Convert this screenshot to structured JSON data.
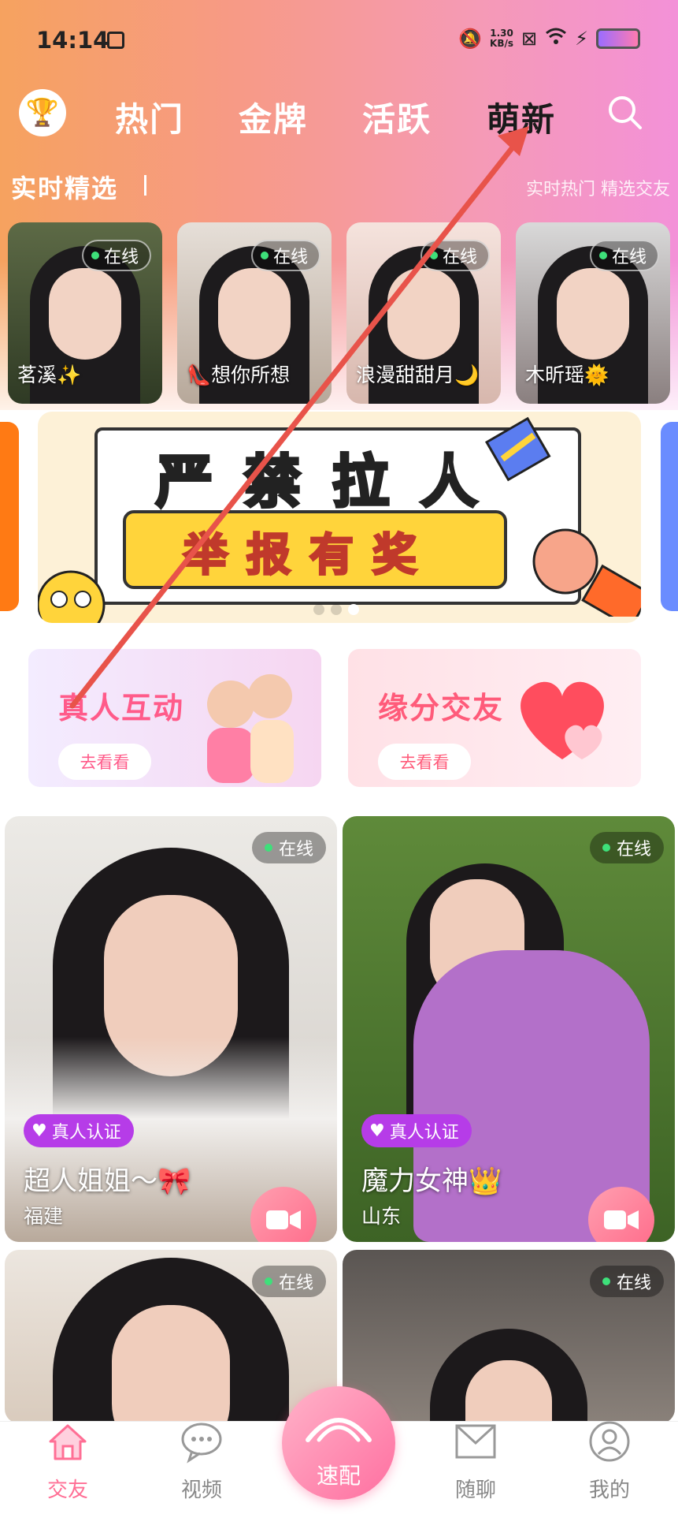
{
  "status": {
    "time": "14:14",
    "net_speed_value": "1.30",
    "net_speed_unit": "KB/s"
  },
  "nav": {
    "tabs": [
      "热门",
      "金牌",
      "活跃",
      "萌新"
    ],
    "active_tab": "萌新"
  },
  "section": {
    "title": "实时精选",
    "right_links": "实时热门  精选交友"
  },
  "live_cards": [
    {
      "badge": "在线",
      "name": "茗溪✨"
    },
    {
      "badge": "在线",
      "name": "👠想你所想"
    },
    {
      "badge": "在线",
      "name": "浪漫甜甜月🌙"
    },
    {
      "badge": "在线",
      "name": "木昕瑶🌞"
    }
  ],
  "banner": {
    "headline": "严禁拉人",
    "subline": "举报有奖"
  },
  "features": [
    {
      "title": "真人互动",
      "button": "去看看"
    },
    {
      "title": "缘分交友",
      "button": "去看看"
    }
  ],
  "profiles": [
    {
      "online": "在线",
      "verify": "真人认证",
      "nickname": "超人姐姐～🎀",
      "location": "福建"
    },
    {
      "online": "在线",
      "verify": "真人认证",
      "nickname": "魔力女神👑",
      "location": "山东"
    },
    {
      "online": "在线"
    },
    {
      "online": "在线"
    }
  ],
  "bottom_nav": {
    "items": [
      "交友",
      "视频",
      "速配",
      "随聊",
      "我的"
    ],
    "active": "交友"
  },
  "colors": {
    "accent_pink": "#ff6f95",
    "online_green": "#3ee07a",
    "verify_purple": "#b63ce8",
    "annotation_arrow": "#e8534a"
  }
}
